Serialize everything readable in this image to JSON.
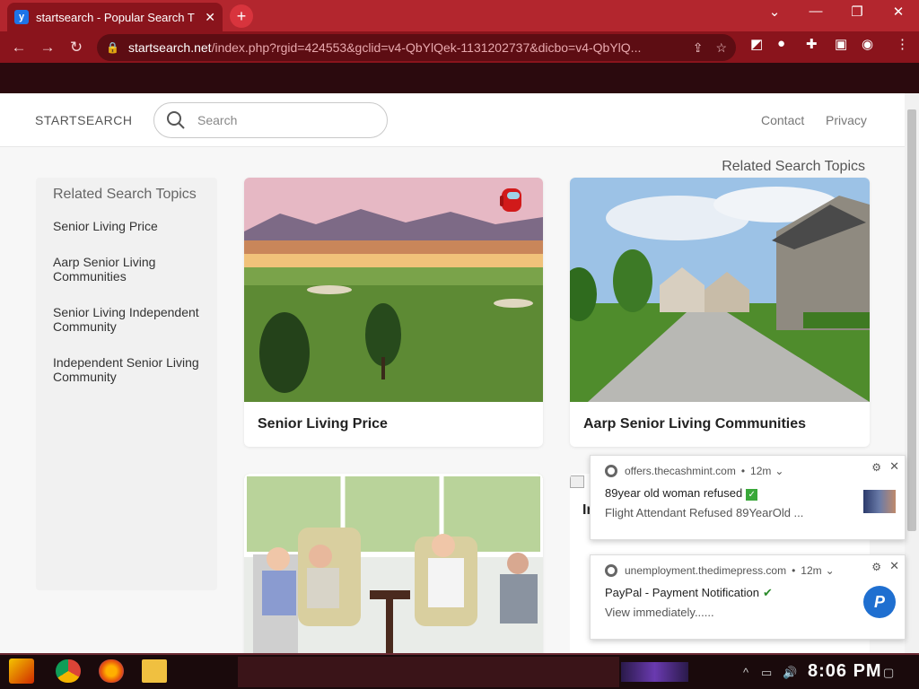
{
  "browser": {
    "tab_title": "startsearch - Popular Search T",
    "tab_favicon": "y",
    "new_tab": "+",
    "url_host": "startsearch.net",
    "url_path": "/index.php?rgid=424553&gclid=v4-QbYlQek-1131202737&dicbo=v4-QbYlQ..."
  },
  "header": {
    "brand": "STARTSEARCH",
    "search_placeholder": "Search",
    "links": [
      "Contact",
      "Privacy"
    ]
  },
  "related_title": "Related Search Topics",
  "sidebar": {
    "title": "Related Search Topics",
    "items": [
      "Senior Living Price",
      "Aarp Senior Living Communities",
      "Senior Living Independent Community",
      "Independent Senior Living Community"
    ]
  },
  "cards": [
    {
      "caption": "Senior Living Price"
    },
    {
      "caption": "Aarp Senior Living Communities"
    },
    {
      "caption": ""
    },
    {
      "caption": "In"
    }
  ],
  "notifications": [
    {
      "source": "offers.thecashmint.com",
      "age": "12m",
      "title": "89year old woman refused",
      "message": "Flight Attendant Refused 89YearOld ..."
    },
    {
      "source": "unemployment.thedimepress.com",
      "age": "12m",
      "title": "PayPal - Payment Notification",
      "message": "View immediately......"
    }
  ],
  "taskbar": {
    "clock": "8:06 PM"
  },
  "colors": {
    "chrome_accent": "#b3262e",
    "page_bg": "#f7f7f7"
  }
}
